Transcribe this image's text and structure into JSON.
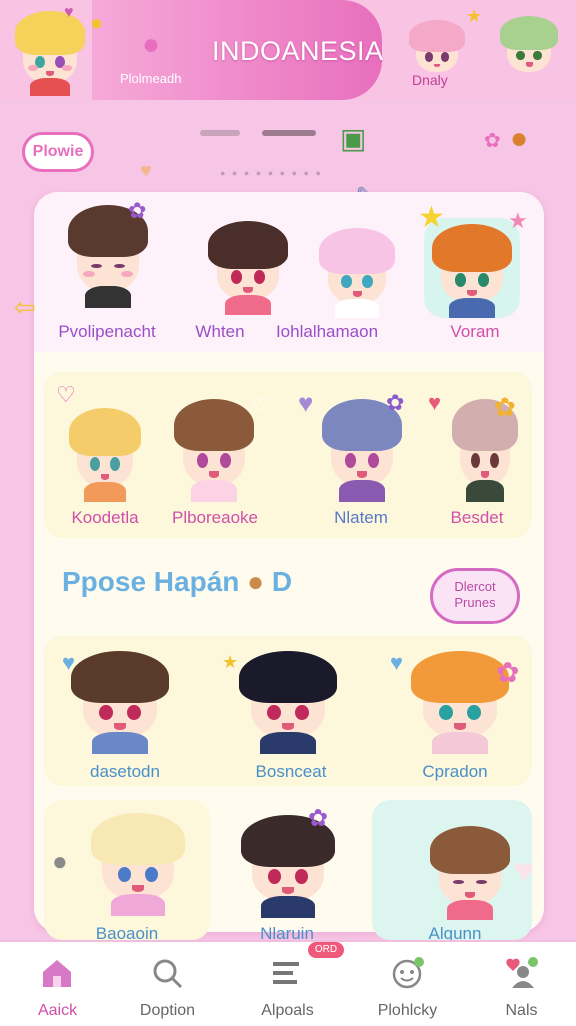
{
  "header": {
    "title": "INDOANESIA",
    "subtitle": "Plolmeadh",
    "right_label": "Dnaly"
  },
  "tag_label": "Plowie",
  "sections": {
    "row1": [
      "Pvolipenacht",
      "Whten",
      "Iohlalhamaon",
      "Voram"
    ],
    "row2": [
      "Koodetla",
      "Plboreaoke",
      "Nlatem",
      "Besdet"
    ],
    "middle_title": "Ppose Hapán",
    "middle_suffix": "D",
    "bubble_text": "Dlercot Prunes",
    "row3": [
      "dasetodn",
      "Bosnceat",
      "Cpradon"
    ],
    "row4": [
      "Baoaoin",
      "Nlaruin",
      "Algunn"
    ]
  },
  "tabbar": {
    "tabs": [
      {
        "label": "Aaick",
        "icon": "home-icon",
        "active": true
      },
      {
        "label": "Doption",
        "icon": "search-icon",
        "active": false
      },
      {
        "label": "Alpoals",
        "icon": "list-icon",
        "active": false
      },
      {
        "label": "Plohlcky",
        "icon": "face-icon",
        "active": false
      },
      {
        "label": "Nals",
        "icon": "heart-user-icon",
        "active": false
      }
    ],
    "badge": "ORD"
  },
  "colors": {
    "accent": "#e86fbd",
    "background": "#f7c6e6",
    "card": "#fffcef",
    "section_title": "#6ab0e0"
  }
}
